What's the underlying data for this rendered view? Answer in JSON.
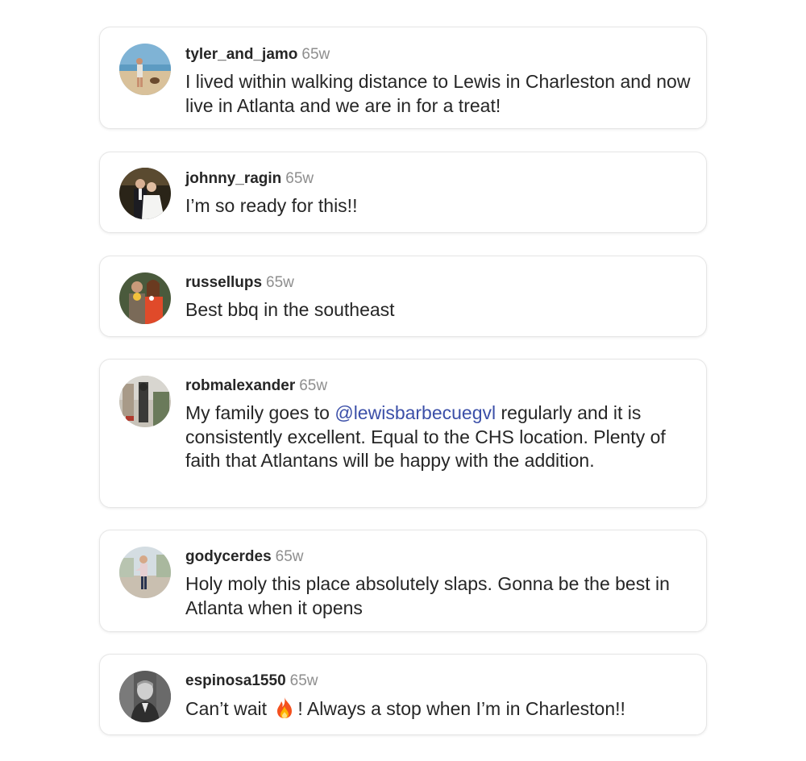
{
  "comments": [
    {
      "username": "tyler_and_jamo",
      "age": "65w",
      "text": "I lived within walking distance to Lewis in Charleston and now live in Atlanta and we are in for a treat!"
    },
    {
      "username": "johnny_ragin",
      "age": "65w",
      "text": "I’m so ready for this!!"
    },
    {
      "username": "russellups",
      "age": "65w",
      "text": "Best bbq in the southeast"
    },
    {
      "username": "robmalexander",
      "age": "65w",
      "text_before": "My family goes to ",
      "mention": "@lewisbarbecuegvl",
      "text_after": " regularly and it is consistently excellent. Equal to the CHS location. Plenty of faith that Atlantans will be happy with the addition."
    },
    {
      "username": "godycerdes",
      "age": "65w",
      "text": "Holy moly this place absolutely slaps. Gonna be the best in Atlanta when it opens"
    },
    {
      "username": "espinosa1550",
      "age": "65w",
      "text_before": "Can’t wait ",
      "emoji": "fire-icon",
      "text_after": "! Always a stop when I’m in Charleston!!"
    }
  ],
  "colors": {
    "username": "#262626",
    "age": "#8e8e8e",
    "mention": "#3b4fa8",
    "card_border": "#e6e6e6"
  }
}
